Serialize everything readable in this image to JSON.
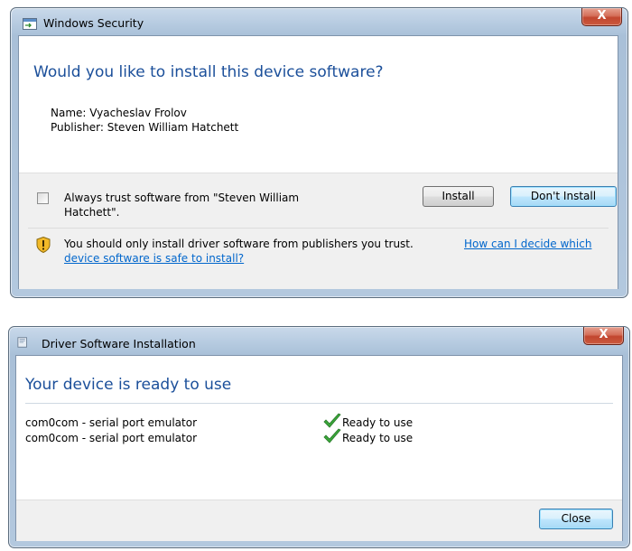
{
  "security_dialog": {
    "title": "Windows Security",
    "close_glyph": "X",
    "heading": "Would you like to install this device software?",
    "name_line": "Name: Vyacheslav Frolov",
    "publisher_line": "Publisher: Steven William Hatchett",
    "trust_checkbox_line1": "Always trust software from \"Steven William",
    "trust_checkbox_line2": "Hatchett\".",
    "install_button": "Install",
    "dont_install_button": "Don't Install",
    "warning_text": "You should only install driver software from publishers you trust.",
    "help_link_line1": "How can I decide which",
    "help_link_line2": "device software is safe to install?",
    "icons": {
      "title": "security-window-icon",
      "warning": "shield-warning-icon"
    }
  },
  "install_dialog": {
    "title": "Driver Software Installation",
    "close_glyph": "X",
    "heading": "Your device is ready to use",
    "devices": [
      {
        "name": "com0com - serial port emulator",
        "status": "Ready to use"
      },
      {
        "name": "com0com - serial port emulator",
        "status": "Ready to use"
      }
    ],
    "close_button": "Close",
    "icons": {
      "title": "driver-install-icon",
      "status": "green-checkmark-icon"
    }
  },
  "colors": {
    "heading_blue": "#1b4f9a",
    "link_blue": "#0066cc",
    "frame_blue": "#b3c8de",
    "close_red": "#c2462f",
    "check_green": "#3aa73a"
  }
}
